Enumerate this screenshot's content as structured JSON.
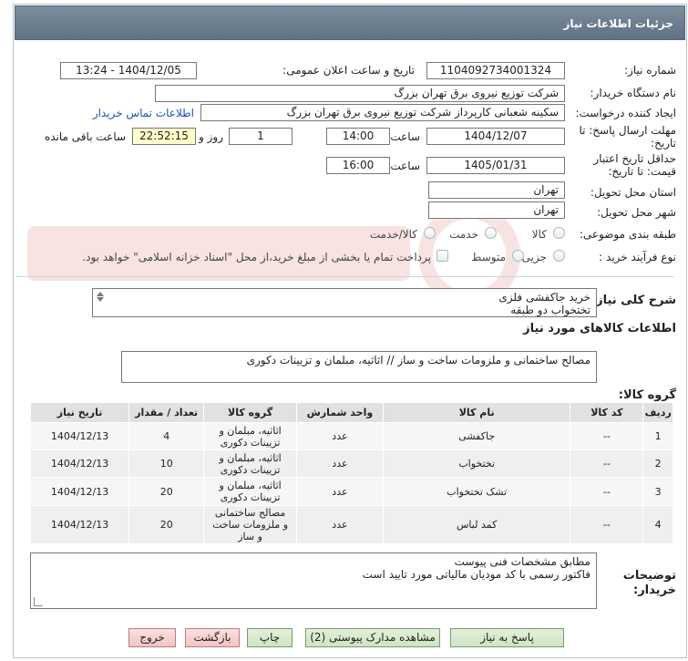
{
  "window": {
    "title": "جزئیات اطلاعات نیاز"
  },
  "form": {
    "need_number": {
      "label": "شماره نیاز:",
      "value": "1104092734001324"
    },
    "announce_datetime": {
      "label": "تاریخ و ساعت اعلان عمومی:",
      "value": "1404/12/05 - 13:24"
    },
    "buyer_org": {
      "label": "نام دستگاه خریدار:",
      "value": "شرکت توزیع نیروی برق تهران بزرگ"
    },
    "requester": {
      "label": "ایجاد کننده درخواست:",
      "value": "سکینه شعبانی کارپرداز شرکت توزیع نیروی برق تهران بزرگ",
      "contact_link": "اطلاعات تماس خریدار"
    },
    "reply_deadline": {
      "label_line1": "مهلت ارسال پاسخ: تا",
      "label_line2": "تاریخ:",
      "date": "1404/12/07",
      "time_label": "ساعت",
      "time": "14:00",
      "days": "1",
      "days_label": "روز و",
      "remaining": "22:52:15",
      "remaining_label": "ساعت باقی مانده"
    },
    "price_validity": {
      "label_line1": "حداقل تاریخ اعتبار",
      "label_line2": "قیمت: تا تاریخ:",
      "date": "1405/01/31",
      "time_label": "ساعت",
      "time": "16:00"
    },
    "province": {
      "label": "استان محل تحویل:",
      "value": "تهران"
    },
    "city": {
      "label": "شهر محل تحویل:",
      "value": "تهران"
    },
    "category": {
      "label": "طبقه بندی موضوعی:",
      "options": [
        "کالا",
        "خدمت",
        "کالا/خدمت"
      ]
    },
    "process_type": {
      "label": "نوع فرآیند خرید :",
      "options": [
        "جزیی",
        "متوسط"
      ],
      "payment_note": "پرداخت تمام یا بخشی از مبلغ خرید،از محل \"اسناد خزانه اسلامی\" خواهد بود."
    }
  },
  "summary": {
    "label": "شرح کلی نیاز:",
    "line1": "خرید جاکفشی فلزی",
    "line2": "تختخواب  دو طبقه"
  },
  "goods_info": {
    "title": "اطلاعات کالاهای مورد نیاز"
  },
  "goods_group": {
    "label": "گروه کالا:",
    "value": "مصالح ساختمانی و ملزومات ساخت و ساز // اثاثیه، مبلمان و تزیینات دکوری"
  },
  "table": {
    "headers": [
      "ردیف",
      "کد کالا",
      "نام کالا",
      "واحد شمارش",
      "گروه کالا",
      "تعداد / مقدار",
      "تاریخ نیاز"
    ],
    "rows": [
      {
        "row": "1",
        "code": "--",
        "name": "جاکفشی",
        "unit": "عدد",
        "group_l1": "اثاثیه، مبلمان و",
        "group_l2": "تزیینات دکوری",
        "group_l3": "",
        "qty": "4",
        "date": "1404/12/13"
      },
      {
        "row": "2",
        "code": "--",
        "name": "تختخواب",
        "unit": "عدد",
        "group_l1": "اثاثیه، مبلمان و",
        "group_l2": "تزیینات دکوری",
        "group_l3": "",
        "qty": "10",
        "date": "1404/12/13"
      },
      {
        "row": "3",
        "code": "--",
        "name": "تشک تختخواب",
        "unit": "عدد",
        "group_l1": "اثاثیه، مبلمان و",
        "group_l2": "تزیینات دکوری",
        "group_l3": "",
        "qty": "20",
        "date": "1404/12/13"
      },
      {
        "row": "4",
        "code": "--",
        "name": "کمد لباس",
        "unit": "عدد",
        "group_l1": "مصالح ساختمانی",
        "group_l2": "و ملزومات ساخت",
        "group_l3": "و ساز",
        "qty": "20",
        "date": "1404/12/13"
      }
    ]
  },
  "buyer_notes": {
    "label_line1": "توضیحات",
    "label_line2": "خریدار:",
    "line1": "مطابق مشخصات فنی پیوست",
    "line2": "فاکتور رسمی با کد مودیان مالیاتی مورد تایید است"
  },
  "buttons": {
    "reply": "پاسخ به نیاز",
    "view_docs": "مشاهده مدارک پیوستی (2)",
    "print": "چاپ",
    "back": "بازگشت",
    "exit": "خروج"
  },
  "colors": {
    "title_bar": "#6b7d8d",
    "button_green": "#d7ead0",
    "button_red": "#f6d3d3",
    "highlight_yellow": "#ffffcc",
    "link_blue": "#1a55b8"
  }
}
